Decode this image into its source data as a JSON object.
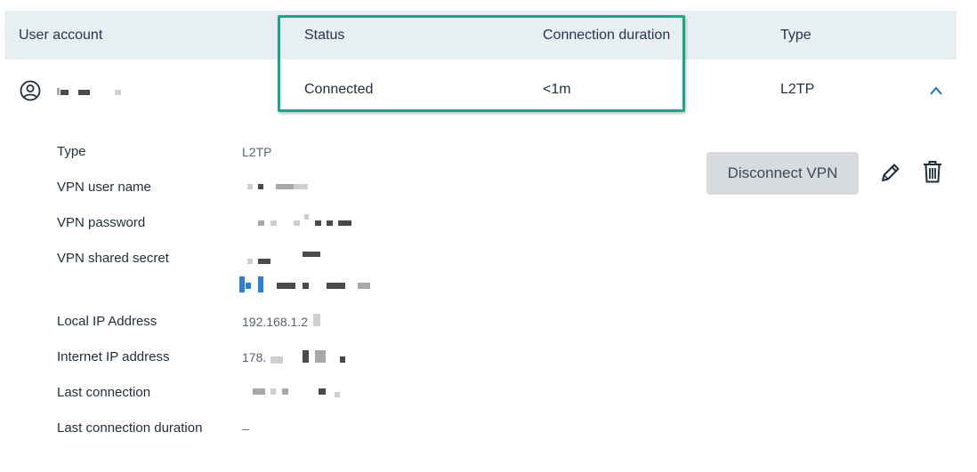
{
  "table": {
    "headers": {
      "user_account": "User account",
      "status": "Status",
      "connection_duration": "Connection duration",
      "type": "Type"
    },
    "row": {
      "status": "Connected",
      "connection_duration": "<1m",
      "type": "L2TP"
    }
  },
  "details": {
    "type_label": "Type",
    "type_value": "L2TP",
    "vpn_user_name_label": "VPN user name",
    "vpn_password_label": "VPN password",
    "vpn_shared_secret_label": "VPN shared secret",
    "local_ip_label": "Local IP Address",
    "local_ip_value": "192.168.1.2",
    "internet_ip_label": "Internet IP address",
    "internet_ip_value": "178.",
    "last_connection_label": "Last connection",
    "last_connection_duration_label": "Last connection duration",
    "last_connection_duration_value": "–"
  },
  "actions": {
    "disconnect_label": "Disconnect VPN"
  },
  "colors": {
    "header_bg": "#e8eff3",
    "highlight": "#17a68c",
    "accent": "#1a73c8",
    "button_bg": "#d7dbdf"
  },
  "icons": [
    "user-circle-icon",
    "chevron-up-icon",
    "pencil-icon",
    "trash-icon"
  ]
}
